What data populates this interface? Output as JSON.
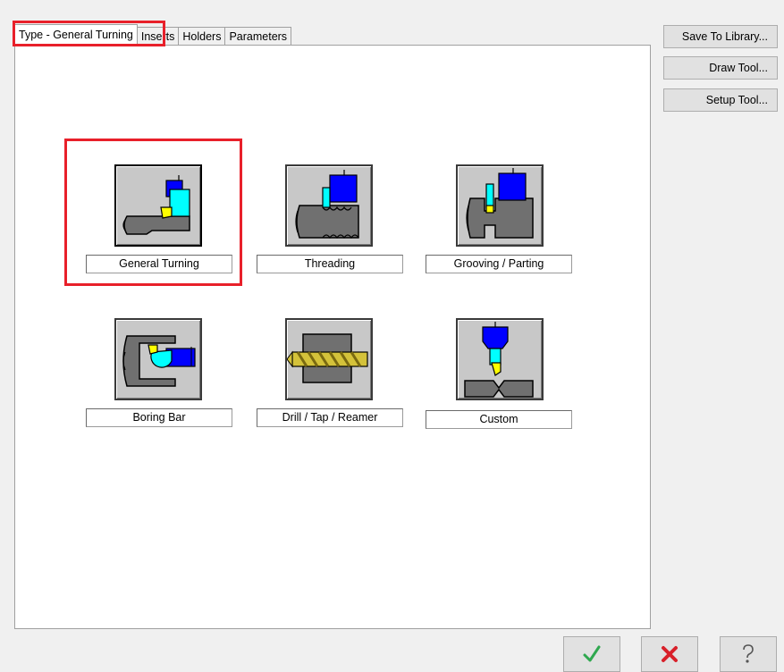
{
  "tabs": [
    {
      "label": "Type - General Turning",
      "active": true
    },
    {
      "label": "Inserts"
    },
    {
      "label": "Holders"
    },
    {
      "label": "Parameters"
    }
  ],
  "side_buttons": {
    "save": "Save To Library...",
    "draw": "Draw Tool...",
    "setup": "Setup Tool..."
  },
  "tool_types": [
    {
      "label": "General Turning",
      "icon": "general-turning-icon",
      "selected": true
    },
    {
      "label": "Threading",
      "icon": "threading-icon"
    },
    {
      "label": "Grooving / Parting",
      "icon": "grooving-parting-icon"
    },
    {
      "label": "Boring Bar",
      "icon": "boring-bar-icon"
    },
    {
      "label": "Drill / Tap / Reamer",
      "icon": "drill-tap-reamer-icon"
    },
    {
      "label": "Custom",
      "icon": "custom-icon"
    }
  ],
  "bottom_buttons": [
    {
      "icon": "ok-checkmark-icon"
    },
    {
      "icon": "cancel-x-icon"
    },
    {
      "icon": "help-question-icon"
    }
  ],
  "colors": {
    "highlight": "#e8202a",
    "tool_blue": "#0000ff",
    "tool_cyan": "#00ffff",
    "insert_yellow": "#ffff00",
    "stock_gray": "#707070"
  }
}
